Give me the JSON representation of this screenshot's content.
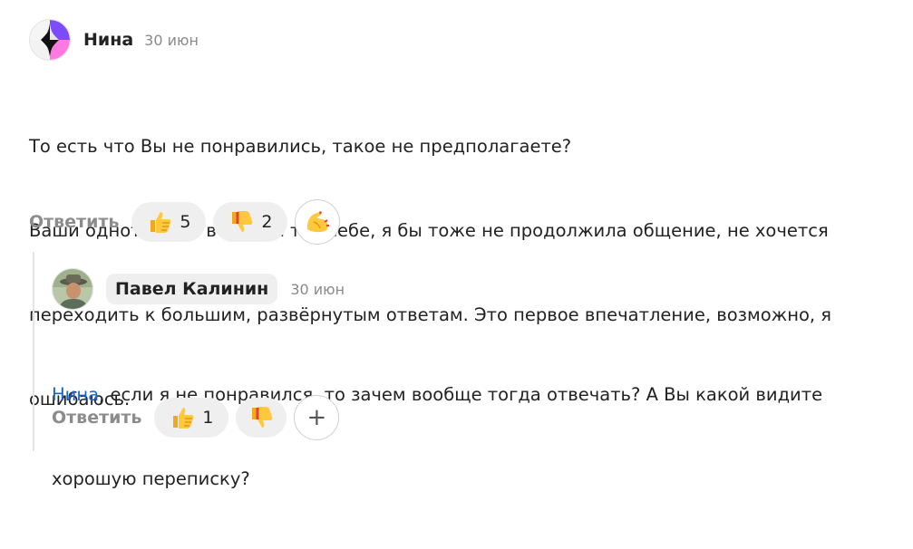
{
  "comment1": {
    "author": "Нина",
    "date": "30 июн",
    "text_lines": [
      "То есть что Вы не понравились, такое не предполагаете?",
      "Ваши однотипные вопросы так себе, я бы тоже не продолжила общение, не хочется",
      "переходить к большим, развёрнутым ответам. Это первое впечатление, возможно, я",
      "ошибаюсь."
    ],
    "reply_label": "Ответить",
    "likes": "5",
    "dislikes": "2",
    "icons": {
      "like": "thumbs-up-icon",
      "dislike": "thumbs-down-icon",
      "reaction": "flexed-biceps-icon"
    }
  },
  "comment2": {
    "author": "Павел Калинин",
    "date": "30 июн",
    "mention": "Нина",
    "text_rest_line1": ", если я не понравился, то зачем вообще тогда отвечать? А Вы какой видите",
    "text_line2": "хорошую переписку?",
    "reply_label": "Ответить",
    "likes": "1",
    "add_reaction": "+",
    "icons": {
      "like": "thumbs-up-icon",
      "dislike": "thumbs-down-icon",
      "add": "plus-icon"
    }
  },
  "colors": {
    "mention": "#1a63c7",
    "pill_bg": "#efefef",
    "muted": "#8c8c8c"
  }
}
